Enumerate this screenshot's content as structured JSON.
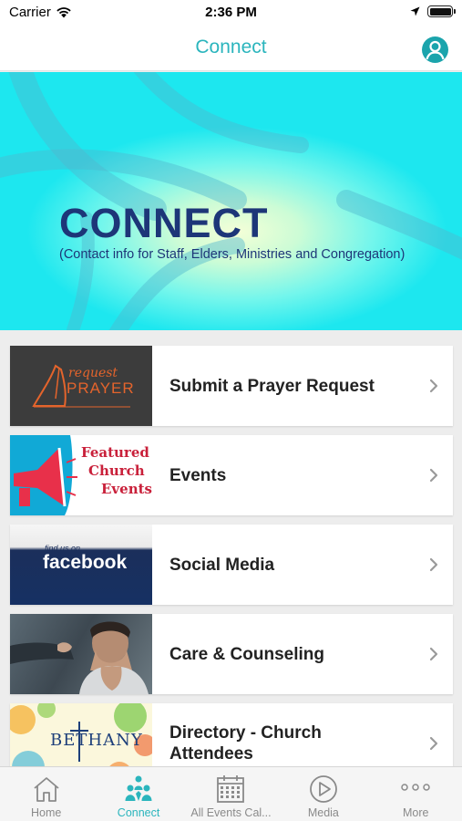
{
  "status_bar": {
    "carrier": "Carrier",
    "time": "2:36 PM"
  },
  "nav": {
    "title": "Connect",
    "profile_icon": "person-circle-icon"
  },
  "banner": {
    "title": "CONNECT",
    "subtitle": "(Contact info for Staff, Elders, Ministries and Congregation)"
  },
  "list": [
    {
      "label": "Submit a Prayer Request",
      "thumb_text_line1": "request",
      "thumb_text_line2": "PRAYER"
    },
    {
      "label": "Events",
      "thumb_text_line1": "Featured",
      "thumb_text_line2": "Church",
      "thumb_text_line3": "Events"
    },
    {
      "label": "Social Media",
      "thumb_text_line1": "find us on",
      "thumb_text_line2": "facebook"
    },
    {
      "label": "Care & Counseling"
    },
    {
      "label": "Directory - Church Attendees",
      "thumb_text_line1": "BETHANY"
    }
  ],
  "tabs": [
    {
      "label": "Home",
      "icon": "house-icon"
    },
    {
      "label": "Connect",
      "icon": "people-icon",
      "active": true
    },
    {
      "label": "All Events Cal...",
      "icon": "calendar-icon"
    },
    {
      "label": "Media",
      "icon": "play-circle-icon"
    },
    {
      "label": "More",
      "icon": "more-dots-icon"
    }
  ],
  "colors": {
    "accent": "#2bb5bd",
    "banner_text": "#1d3678",
    "banner_bg": "#1de7ef"
  }
}
